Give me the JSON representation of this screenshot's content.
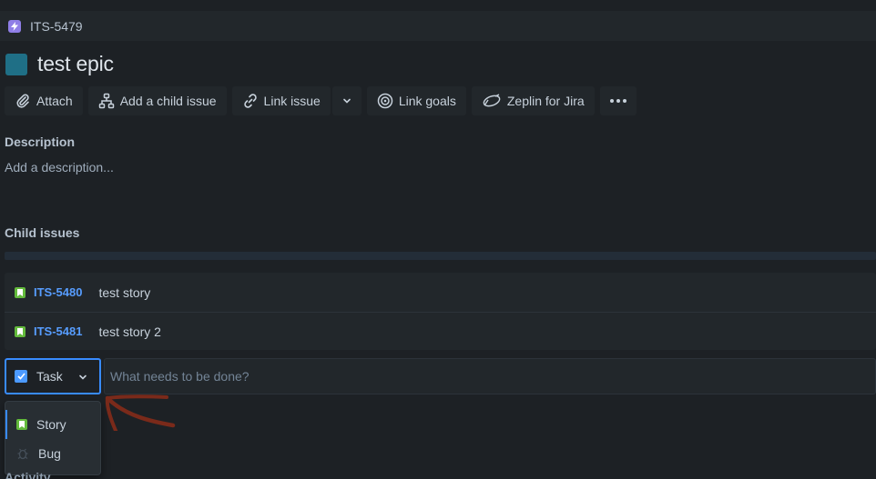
{
  "header": {
    "ticket_key": "ITS-5479",
    "ticket_icon": "lightning-icon"
  },
  "issue": {
    "title": "test epic",
    "type_color": "#1f6f86"
  },
  "toolbar": {
    "attach_label": "Attach",
    "add_child_label": "Add a child issue",
    "link_issue_label": "Link issue",
    "link_goals_label": "Link goals",
    "zeplin_label": "Zeplin for Jira"
  },
  "description": {
    "heading": "Description",
    "placeholder": "Add a description..."
  },
  "child_issues": {
    "heading": "Child issues",
    "items": [
      {
        "key": "ITS-5480",
        "summary": "test story",
        "type": "story"
      },
      {
        "key": "ITS-5481",
        "summary": "test story 2",
        "type": "story"
      }
    ]
  },
  "create": {
    "selected_type": "Task",
    "summary_placeholder": "What needs to be done?",
    "options": [
      {
        "label": "Story",
        "icon": "story-icon"
      },
      {
        "label": "Bug",
        "icon": "bug-icon"
      }
    ]
  },
  "activity": {
    "heading": "Activity"
  },
  "colors": {
    "background": "#1d2125",
    "surface": "#22272b",
    "link": "#579dff",
    "focus": "#388bff",
    "story_green": "#63ba3c",
    "annotation": "#7a2a1a"
  }
}
